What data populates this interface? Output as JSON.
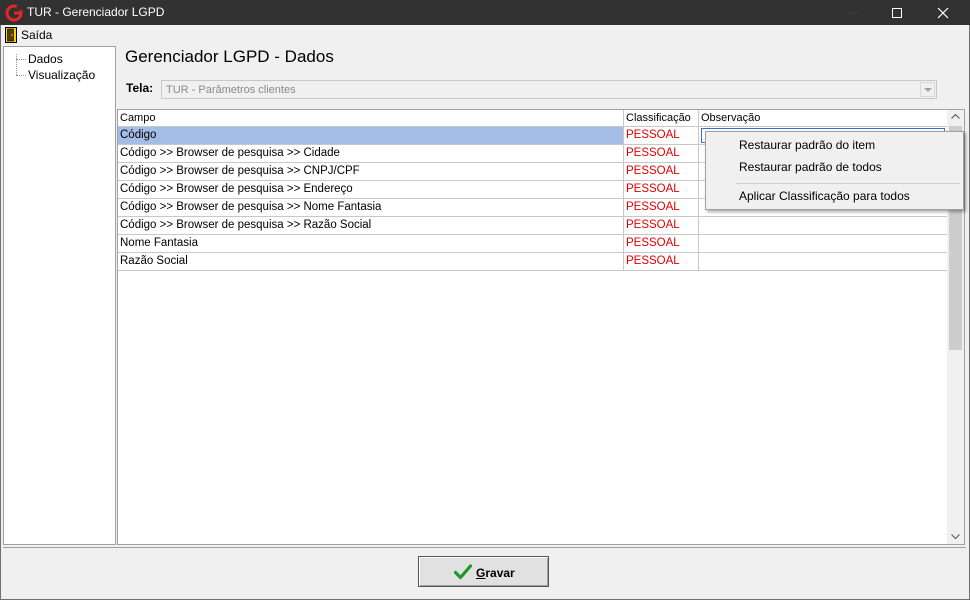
{
  "window": {
    "title": "TUR - Gerenciador LGPD",
    "controls": [
      "minimize-icon",
      "maximize-icon",
      "close-icon"
    ]
  },
  "menubar": {
    "items": [
      {
        "label": "Saída",
        "icon": "exit-door-icon"
      }
    ]
  },
  "sidebar": {
    "items": [
      {
        "label": "Dados"
      },
      {
        "label": "Visualização"
      }
    ]
  },
  "main": {
    "title": "Gerenciador LGPD - Dados",
    "tela": {
      "label": "Tela:",
      "value": "TUR - Parâmetros clientes"
    }
  },
  "grid": {
    "columns": [
      "Campo",
      "Classificação",
      "Observação"
    ],
    "rows": [
      {
        "campo": "Código",
        "classificacao": "PESSOAL",
        "observacao": ""
      },
      {
        "campo": "Código >> Browser de pesquisa >> Cidade",
        "classificacao": "PESSOAL",
        "observacao": ""
      },
      {
        "campo": "Código >> Browser de pesquisa >> CNPJ/CPF",
        "classificacao": "PESSOAL",
        "observacao": ""
      },
      {
        "campo": "Código >> Browser de pesquisa >> Endereço",
        "classificacao": "PESSOAL",
        "observacao": ""
      },
      {
        "campo": "Código >> Browser de pesquisa >> Nome Fantasia",
        "classificacao": "PESSOAL",
        "observacao": ""
      },
      {
        "campo": "Código >> Browser de pesquisa >> Razão Social",
        "classificacao": "PESSOAL",
        "observacao": ""
      },
      {
        "campo": "Nome Fantasia",
        "classificacao": "PESSOAL",
        "observacao": ""
      },
      {
        "campo": "Razão Social",
        "classificacao": "PESSOAL",
        "observacao": ""
      }
    ],
    "selected_row": 0
  },
  "context_menu": {
    "items": [
      {
        "label": "Restaurar padrão do item"
      },
      {
        "label": "Restaurar padrão de todos"
      },
      {
        "label": "Aplicar Classificação para todos"
      }
    ]
  },
  "footer": {
    "save_label": "Gravar",
    "save_icon": "checkmark-icon"
  },
  "colors": {
    "titlebar": "#323232",
    "selection": "#a3bde6",
    "classification_text": "#e00000",
    "checkmark": "#1a9a2a"
  }
}
